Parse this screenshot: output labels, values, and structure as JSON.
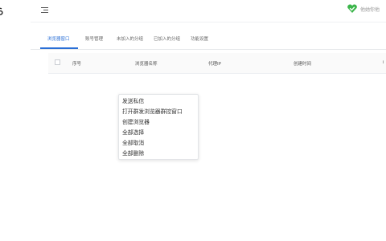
{
  "sidebar": {
    "logo_text": "ら"
  },
  "topbar": {
    "brand_name": "他她你他",
    "brand_color": "#3bb54a"
  },
  "tabs": [
    {
      "label": "浏览器窗口",
      "active": true
    },
    {
      "label": "账号管理"
    },
    {
      "label": "未加入的分组"
    },
    {
      "label": "已加入的分组"
    },
    {
      "label": "功能设置"
    }
  ],
  "table": {
    "columns": [
      "序号",
      "浏览器名称",
      "代理IP",
      "创建时间",
      "i"
    ]
  },
  "context_menu": {
    "items": [
      "发送私信",
      "打开群发浏览器群控窗口",
      "创建浏览器",
      "全部选择",
      "全部取消",
      "全部删除"
    ]
  },
  "colors": {
    "accent": "#2a6fd6",
    "sidebar_bg": "#ffffff",
    "page_bg": "#f0f2f5"
  },
  "icons": {
    "menu_toggle": "menu-toggle-icon",
    "brand_logo": "heart-shield-icon",
    "checkbox": "checkbox-icon"
  }
}
